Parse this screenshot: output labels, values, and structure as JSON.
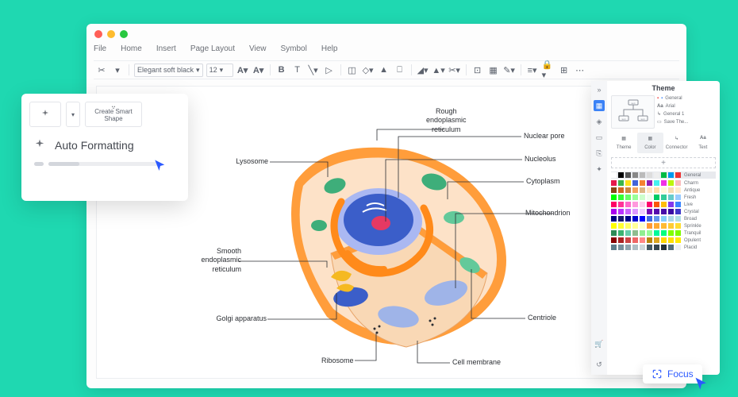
{
  "menus": {
    "file": "File",
    "home": "Home",
    "insert": "Insert",
    "page_layout": "Page Layout",
    "view": "View",
    "symbol": "Symbol",
    "help": "Help"
  },
  "font": {
    "name": "Elegant soft black",
    "size": "12"
  },
  "diagram_labels": {
    "rough_er": "Rough\nendoplasmic\nreticulum",
    "nuclear_pore": "Nuclear pore",
    "lysosome": "Lysosome",
    "nucleolus": "Nucleolus",
    "cytoplasm": "Cytoplasm",
    "mitochondrion": "Mitochondrion",
    "smooth_er": "Smooth\nendoplasmic\nreticulum",
    "golgi": "Golgi apparatus",
    "ribosome": "Ribosome",
    "cell_membrane": "Cell membrane",
    "centriole": "Centriole"
  },
  "smart_popup": {
    "create": "Create Smart\nShape",
    "auto_fmt": "Auto Formatting"
  },
  "theme_panel": {
    "title": "Theme",
    "info_general": "General",
    "info_font": "Arial",
    "info_g1": "General 1",
    "info_save": "Save The...",
    "tabs": {
      "theme": "Theme",
      "color": "Color",
      "connector": "Connector",
      "text": "Text"
    },
    "palettes": [
      "General",
      "Charm",
      "Antique",
      "Fresh",
      "Live",
      "Crystal",
      "Broad",
      "Sprinkle",
      "Tranquil",
      "Opulent",
      "Placid"
    ]
  },
  "focus": "Focus",
  "palette_colors": [
    [
      "#fff",
      "#000",
      "#555",
      "#888",
      "#bbb",
      "#ddd",
      "#eee",
      "#0b4",
      "#09e",
      "#e33"
    ],
    [
      "#e6194b",
      "#3cb44b",
      "#ffe119",
      "#4363d8",
      "#f58231",
      "#911eb4",
      "#46f0f0",
      "#f032e6",
      "#bcf60c",
      "#fabebe"
    ],
    [
      "#8b4513",
      "#d2691e",
      "#cd853f",
      "#f4a460",
      "#deb887",
      "#ffe4c4",
      "#ffdead",
      "#fff8dc",
      "#f5deb3",
      "#ffebcd"
    ],
    [
      "#0f0",
      "#3f3",
      "#6f6",
      "#9f9",
      "#cfc",
      "#efe",
      "#0c6",
      "#3c9",
      "#6cc",
      "#9cf"
    ],
    [
      "#f06",
      "#f39",
      "#f6c",
      "#f9d",
      "#fce",
      "#ff006e",
      "#fb5607",
      "#ffbe0b",
      "#8338ec",
      "#3a86ff"
    ],
    [
      "#a0e",
      "#b3f",
      "#c6f",
      "#d9f",
      "#ecf",
      "#7209b7",
      "#560bad",
      "#480ca8",
      "#3a0ca3",
      "#3f37c9"
    ],
    [
      "#000080",
      "#191970",
      "#00008b",
      "#0000cd",
      "#0000ff",
      "#4169e1",
      "#6495ed",
      "#87cefa",
      "#add8e6",
      "#b0e0e6"
    ],
    [
      "#ff0",
      "#ff3",
      "#ff6",
      "#ff9",
      "#ffc",
      "#f93",
      "#fa3",
      "#fb3",
      "#fc3",
      "#fd3"
    ],
    [
      "#2e8b57",
      "#3cb371",
      "#66cdaa",
      "#8fbc8f",
      "#90ee90",
      "#98fb98",
      "#00fa9a",
      "#00ff7f",
      "#7fff00",
      "#7cfc00"
    ],
    [
      "#800",
      "#a22",
      "#c44",
      "#e66",
      "#f88",
      "#b8860b",
      "#daa520",
      "#ffd700",
      "#ffdf00",
      "#ffea00"
    ],
    [
      "#607d8b",
      "#78909c",
      "#90a4ae",
      "#b0bec5",
      "#cfd8dc",
      "#455a64",
      "#37474f",
      "#263238",
      "#546e7a",
      "#eceff1"
    ]
  ]
}
